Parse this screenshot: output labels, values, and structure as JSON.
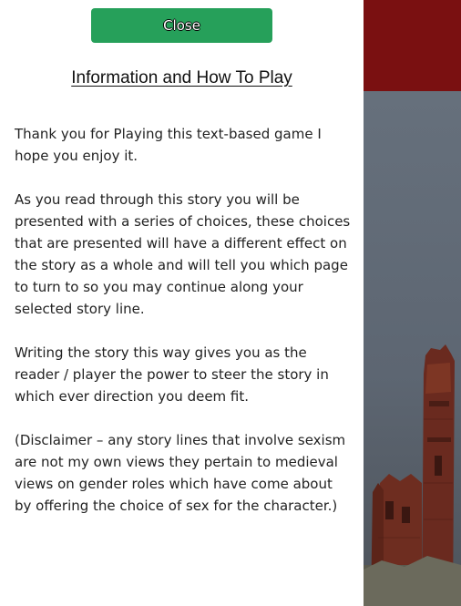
{
  "modal": {
    "close_label": "Close",
    "title": "Information and How To Play",
    "paragraphs": [
      "Thank you for Playing this text-based game I hope you enjoy it.",
      "As you read through this story you will be presented with a series of choices, these choices that are presented will have a different effect on the story as a whole and will tell you which page to turn to so you may continue along your selected story line.",
      "Writing the story this way gives you as the reader / player the power to steer the story in which ever direction you deem fit.",
      "(Disclaimer – any story lines that involve sexism are not my own views they pertain to medieval views on gender roles which have come about by offering the choice of sex for the character.)"
    ]
  },
  "colors": {
    "close_button": "#26a05a",
    "banner": "#7a1011",
    "sky": "#5f6670"
  }
}
